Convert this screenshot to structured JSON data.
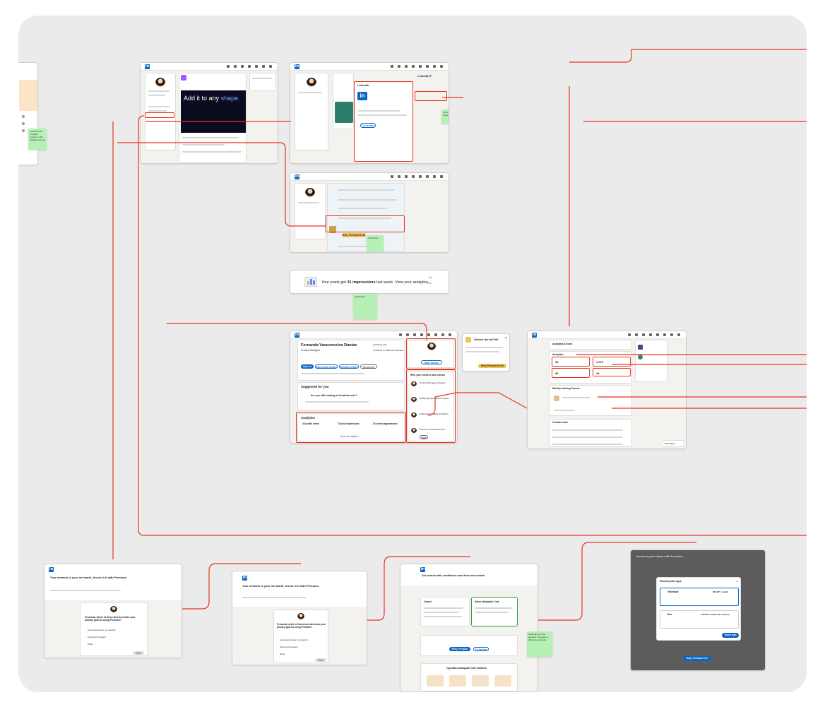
{
  "colors": {
    "brand": "#0a66c2",
    "connector": "#e8341c",
    "sticky": "#b6f0b4",
    "premium": "#f0c35b"
  },
  "frame_a": {
    "feed_post_headline": "Add it to any",
    "feed_post_highlight": "shape.",
    "sticky": "LinkedIn side scrollbar premium, with multiple features"
  },
  "frame_b": {
    "modal_title": "LinkedIn",
    "modal_button": "Try for free",
    "sticky": "Inbox message",
    "header": "LinkedIn P"
  },
  "frame_c": {
    "premium_button": "Retry Premium for $0",
    "sticky": "Notification"
  },
  "frame_d": {
    "text_prefix": "Your posts got",
    "text_bold": "31 impressions",
    "text_suffix": "last week. View your analytics.",
    "time": "2w",
    "more_icon": "···",
    "sticky": "Notification"
  },
  "profile": {
    "name": "Fernanda Vasconcelos Dantas",
    "headline": "Product Designer",
    "buttons": [
      "Open to",
      "Add profile section",
      "Enhance profile",
      "Resources"
    ],
    "suggested_title": "Suggested for you",
    "suggested_question": "Are you still working at Academia edu?",
    "analytics_title": "Analytics",
    "analytics": [
      {
        "value": "33 profile views",
        "desc": "Discover who's viewed your profile."
      },
      {
        "value": "72 post impressions",
        "desc": "Check out who's engaging with your posts."
      },
      {
        "value": "23 search appearances",
        "desc": "See how often you appear in search results."
      }
    ],
    "show_all": "Show all analytics →",
    "company_1": "Academia.edu",
    "company_2": "University of California, Berkeley",
    "side_cta": "Retry for free",
    "viewers_title": "Who your viewers also viewed",
    "viewers": [
      "Product Manager at Spotify",
      "Marketing Specialist at Amazon",
      "Marketing Specialist at PayPal",
      "Recruiter at Academia.edu"
    ],
    "view_button": "View"
  },
  "unlock_popup": {
    "title": "Unlock the full list",
    "cta": "Retry Premium for $0"
  },
  "analytics_page": {
    "title": "Analytics & tools",
    "section": "Analytics",
    "stats": [
      "92",
      "1,073",
      "36",
      "23"
    ],
    "weekly_title": "Weekly sharing Course",
    "creator_tools": "Creator tools",
    "messaging": "Messaging"
  },
  "premium_1": {
    "headline": "Your network is your net worth. Invest in it with Premium.",
    "question": "Fernanda, which of these best describes your primary goal for using Premium?",
    "options": [
      "Grow and nurture my network",
      "Find and hire talent",
      "Other"
    ],
    "next": "Next"
  },
  "premium_2": {
    "headline": "Your network is your net worth. Invest in it with Premium.",
    "question": "Fernanda, which of these best describes your primary goal for using Premium?",
    "options": [
      "Grow and nurture my network",
      "Find and hire talent",
      "Other"
    ],
    "next": "Next"
  },
  "premium_3": {
    "headline": "Job search with confidence and drive more leads.",
    "plan_left": "Career",
    "plan_right": "Sales Navigator Core",
    "cta_1": "Retry Premium Free",
    "cta_2": "Try for free",
    "features_title": "Top Sales Navigator Core features",
    "sticky": "Depending on the answers, this page is different & dynamic"
  },
  "premium_4": {
    "headline": "Invest in your future with Premium",
    "modal_title": "Review plan type",
    "option_1": "Individual",
    "option_1_price": "$79.99* / month",
    "option_2": "Duo",
    "option_2_price": "$75.99* / month per account",
    "cta": "Select plan",
    "footer": "Retry Premium Free"
  }
}
